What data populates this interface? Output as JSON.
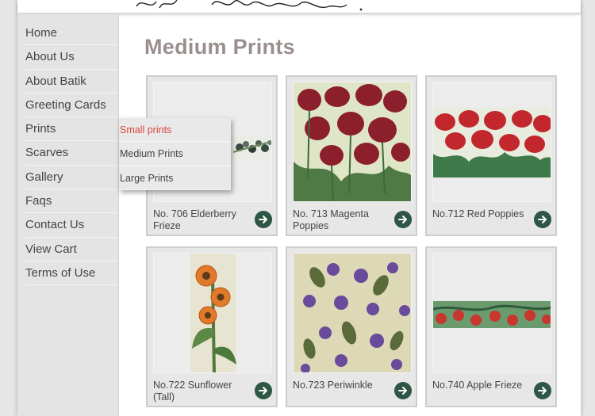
{
  "nav": {
    "items": [
      {
        "label": "Home"
      },
      {
        "label": "About Us"
      },
      {
        "label": "About Batik"
      },
      {
        "label": "Greeting Cards"
      },
      {
        "label": "Prints"
      },
      {
        "label": "Scarves"
      },
      {
        "label": "Gallery"
      },
      {
        "label": "Faqs"
      },
      {
        "label": "Contact Us"
      },
      {
        "label": "View Cart"
      },
      {
        "label": "Terms of Use"
      }
    ],
    "prints_submenu": [
      {
        "label": "Small prints",
        "active": true
      },
      {
        "label": "Medium Prints",
        "active": false
      },
      {
        "label": "Large Prints",
        "active": false
      }
    ]
  },
  "page": {
    "title": "Medium Prints"
  },
  "products": [
    {
      "caption": "No. 706 Elderberry Frieze",
      "icon": "arrow-right-icon"
    },
    {
      "caption": "No. 713 Magenta Poppies",
      "icon": "arrow-right-icon"
    },
    {
      "caption": "No.712 Red Poppies",
      "icon": "arrow-right-icon"
    },
    {
      "caption": "No.722 Sunflower (Tall)",
      "icon": "arrow-right-icon"
    },
    {
      "caption": "No.723 Periwinkle",
      "icon": "arrow-right-icon"
    },
    {
      "caption": "No.740 Apple Frieze",
      "icon": "arrow-right-icon"
    }
  ],
  "colors": {
    "title": "#9a8f8e",
    "active_submenu": "#d9453d",
    "arrow_button": "#2d5645",
    "sidebar": "#e4e4e4"
  }
}
